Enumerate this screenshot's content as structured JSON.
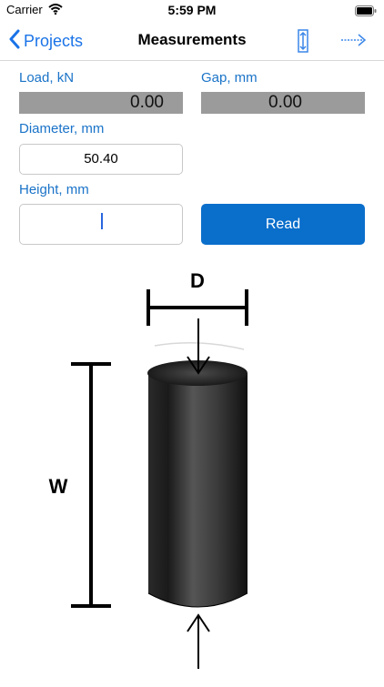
{
  "status_bar": {
    "carrier": "Carrier",
    "time": "5:59 PM"
  },
  "nav": {
    "back_label": "Projects",
    "title": "Measurements"
  },
  "fields": {
    "load": {
      "label": "Load, kN",
      "value": "0.00"
    },
    "gap": {
      "label": "Gap, mm",
      "value": "0.00"
    },
    "diameter": {
      "label": "Diameter, mm",
      "value": "50.40"
    },
    "height": {
      "label": "Height, mm",
      "value": ""
    }
  },
  "read_button": {
    "label": "Read"
  },
  "diagram": {
    "diameter_label": "D",
    "height_label": "W"
  },
  "colors": {
    "accent": "#1a73e8",
    "button": "#0a6ecb",
    "readout_bg": "#9b9b9b"
  }
}
